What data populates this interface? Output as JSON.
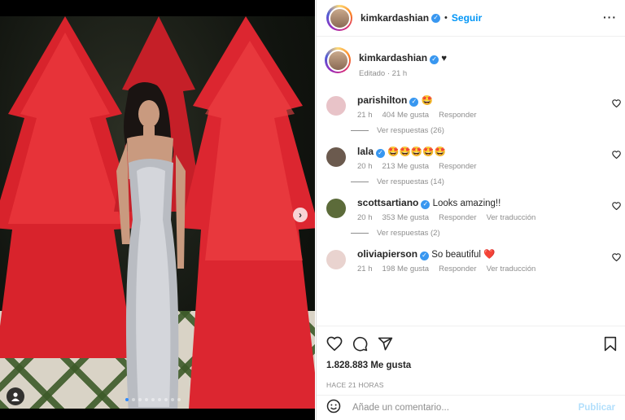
{
  "post": {
    "author": "kimkardashian",
    "follow_label": "Seguir",
    "separator": "•",
    "more_label": "···",
    "caption_text": "♥",
    "caption_meta": "Editado · 21 h",
    "image_alt": "Photo of woman in silver gown in front of red trees"
  },
  "comments": [
    {
      "user": "parishilton",
      "text": "🤩",
      "time": "21 h",
      "likes": "404 Me gusta",
      "reply": "Responder",
      "translate": "",
      "replies": "Ver respuestas (26)",
      "avatar_color": "#e8c3c8"
    },
    {
      "user": "lala",
      "text": "🤩🤩🤩🤩🤩",
      "time": "20 h",
      "likes": "213 Me gusta",
      "reply": "Responder",
      "translate": "",
      "replies": "Ver respuestas (14)",
      "avatar_color": "#6b5a4e"
    },
    {
      "user": "scottsartiano",
      "text": "Looks amazing!!",
      "time": "20 h",
      "likes": "353 Me gusta",
      "reply": "Responder",
      "translate": "Ver traducción",
      "replies": "Ver respuestas (2)",
      "avatar_color": "#5c6b3a"
    },
    {
      "user": "oliviapierson",
      "text": "So beautiful ❤️",
      "time": "21 h",
      "likes": "198 Me gusta",
      "reply": "Responder",
      "translate": "Ver traducción",
      "replies": "",
      "avatar_color": "#e9d3cf"
    }
  ],
  "actions": {
    "icons": [
      "heart-icon",
      "comment-icon",
      "share-icon",
      "bookmark-icon"
    ],
    "likes": "1.828.883 Me gusta",
    "posted_ago": "HACE 21 HORAS",
    "comment_placeholder": "Añade un comentario...",
    "publish_label": "Publicar"
  },
  "carousel": {
    "total": 9,
    "active": 1
  },
  "colors": {
    "accent": "#0095f6",
    "verified": "#3897f0",
    "muted": "#8e8e8e",
    "tree_red": "#e0262e"
  }
}
